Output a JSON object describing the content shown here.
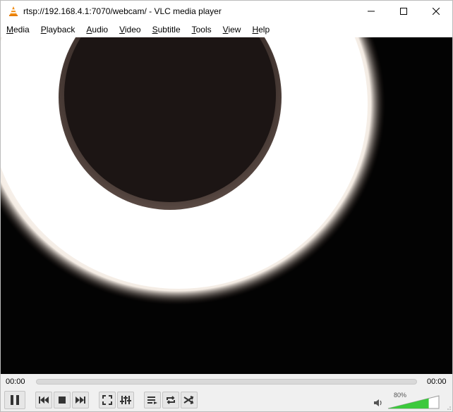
{
  "window": {
    "title": "rtsp://192.168.4.1:7070/webcam/ - VLC media player"
  },
  "menu": [
    {
      "u": "M",
      "rest": "edia"
    },
    {
      "u": "P",
      "rest": "layback"
    },
    {
      "u": "A",
      "rest": "udio"
    },
    {
      "u": "V",
      "rest": "ideo"
    },
    {
      "u": "S",
      "rest": "ubtitle"
    },
    {
      "u": "T",
      "rest": "ools"
    },
    {
      "u": "V",
      "rest": "iew"
    },
    {
      "u": "H",
      "rest": "elp"
    }
  ],
  "playback": {
    "elapsed": "00:00",
    "total": "00:00",
    "progress": 0
  },
  "volume": {
    "label": "80%",
    "level": 0.8,
    "fill_color": "#3cc93c"
  },
  "icons": {
    "app": "vlc-cone-icon",
    "minimize": "minimize-icon",
    "maximize": "maximize-icon",
    "close": "close-icon"
  }
}
